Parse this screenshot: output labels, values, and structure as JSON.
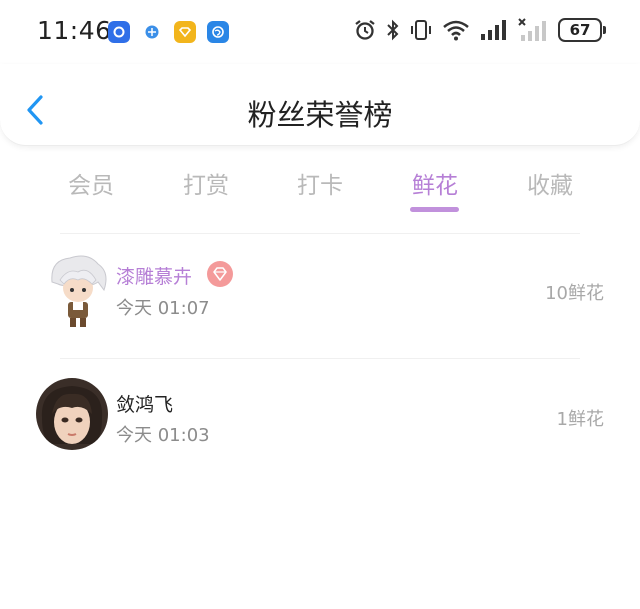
{
  "status_bar": {
    "time": "11:46",
    "battery": "67",
    "app_icons": [
      "notification-app-icon-1",
      "notification-app-icon-2",
      "notification-app-icon-3",
      "notification-app-icon-4"
    ],
    "sys_icons": [
      "alarm-icon",
      "bluetooth-icon",
      "vibrate-icon",
      "wifi-icon",
      "signal-icon",
      "signal-no-service-icon",
      "battery-icon"
    ]
  },
  "header": {
    "title": "粉丝荣誉榜",
    "back_icon": "chevron-left-icon"
  },
  "tabs": [
    {
      "label": "会员",
      "active": false
    },
    {
      "label": "打赏",
      "active": false
    },
    {
      "label": "打卡",
      "active": false
    },
    {
      "label": "鲜花",
      "active": true
    },
    {
      "label": "收藏",
      "active": false
    }
  ],
  "colors": {
    "accent": "#b67fd6",
    "indicator": "#c191dc",
    "inactive_tab": "#b9b9b9",
    "back_arrow": "#2196f3",
    "vip_badge": "#f49a9a",
    "muted_text": "#8c8c8c"
  },
  "fans": [
    {
      "name": "漆雕慕卉",
      "vip": true,
      "time": "今天 01:07",
      "gift": "10鲜花",
      "badge_icon": "diamond-icon"
    },
    {
      "name": "敛鸿飞",
      "vip": false,
      "time": "今天 01:03",
      "gift": "1鲜花"
    }
  ]
}
